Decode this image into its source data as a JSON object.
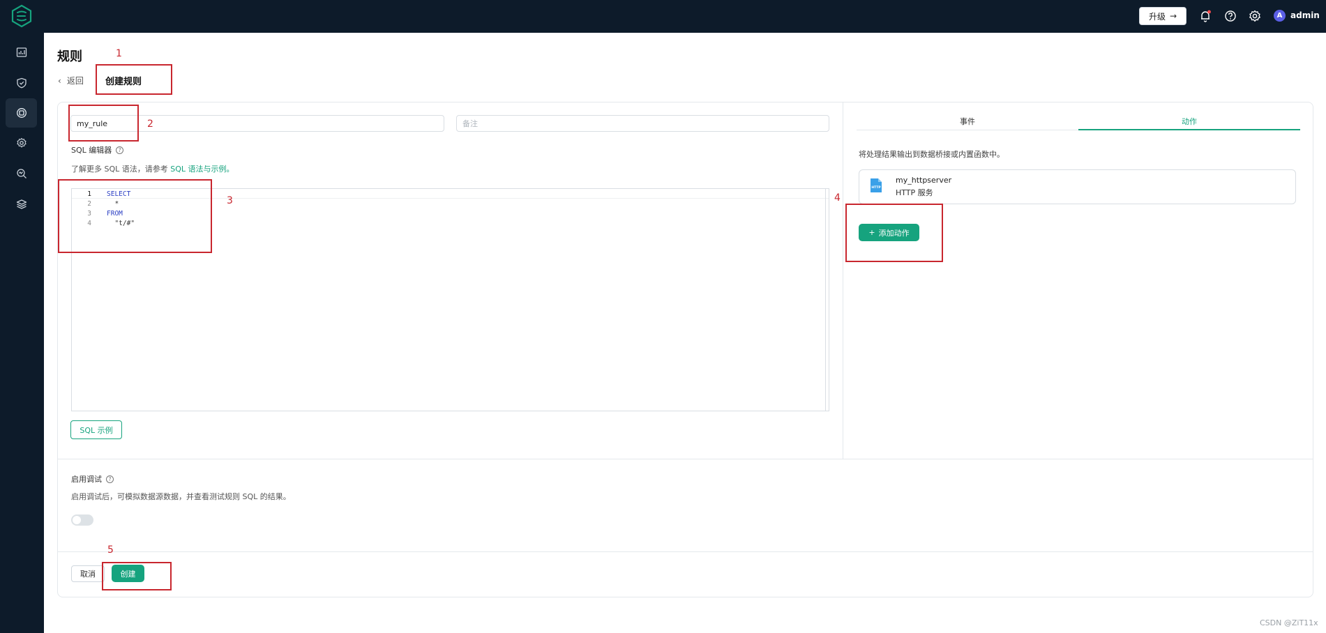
{
  "topbar": {
    "upgrade_label": "升级",
    "username": "admin",
    "avatar_initial": "A",
    "notification_dot_color": "#ff4d4f"
  },
  "sidebar": {
    "items": [
      {
        "icon": "dashboard-icon"
      },
      {
        "icon": "shield-icon"
      },
      {
        "icon": "rules-icon",
        "active": true
      },
      {
        "icon": "gear-icon"
      },
      {
        "icon": "diagnose-icon"
      },
      {
        "icon": "stack-icon"
      }
    ]
  },
  "page": {
    "title": "规则",
    "back_label": "返回",
    "breadcrumb_current": "创建规则"
  },
  "form": {
    "rule_name_value": "my_rule",
    "note_placeholder": "备注",
    "sql_editor_label": "SQL 编辑器",
    "sql_hint_prefix": "了解更多 SQL 语法，请参考",
    "sql_hint_link": "SQL 语法与示例",
    "sql_hint_suffix": "。",
    "sql_lines": [
      {
        "num": "1",
        "text": "SELECT"
      },
      {
        "num": "2",
        "text": "  *"
      },
      {
        "num": "3",
        "text": "FROM"
      },
      {
        "num": "4",
        "text": "  \"t/#\""
      }
    ],
    "sql_example_button": "SQL 示例"
  },
  "right_panel": {
    "tabs": [
      "事件",
      "动作"
    ],
    "active_tab": "动作",
    "description": "将处理结果输出到数据桥接或内置函数中。",
    "actions": [
      {
        "name": "my_httpserver",
        "type": "HTTP 服务",
        "icon_label": "HTTP"
      }
    ],
    "add_action_label": "添加动作"
  },
  "debug": {
    "label": "启用调试",
    "hint": "启用调试后，可模拟数据源数据，并查看测试规则 SQL 的结果。",
    "enabled": false
  },
  "footer": {
    "cancel_label": "取消",
    "create_label": "创建"
  },
  "annotations": [
    "1",
    "2",
    "3",
    "4",
    "5"
  ],
  "watermark": "CSDN @ZiT11x",
  "colors": {
    "accent": "#16a37e",
    "header_bg": "#0d1b2a",
    "annotation": "#c8262e"
  }
}
